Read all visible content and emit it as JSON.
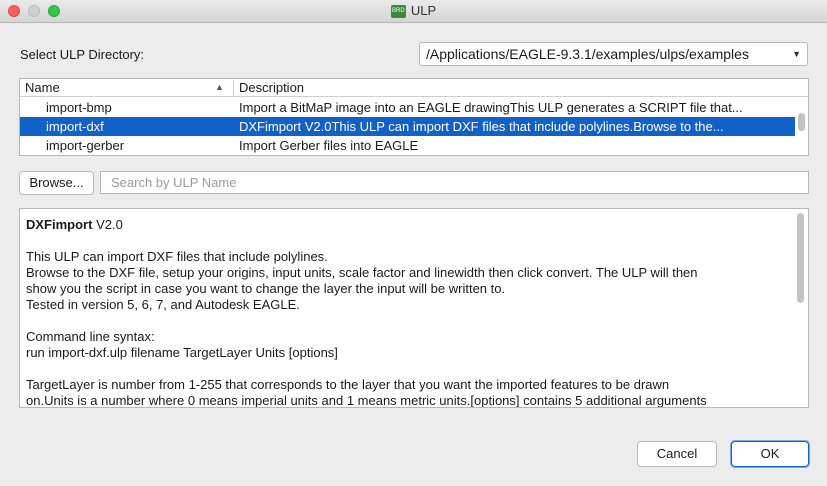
{
  "window": {
    "title": "ULP",
    "app_icon": "eagle-app-icon",
    "icon_text": "BRD"
  },
  "directory": {
    "label": "Select ULP Directory:",
    "value": "/Applications/EAGLE-9.3.1/examples/ulps/examples"
  },
  "table": {
    "columns": [
      "Name",
      "Description"
    ],
    "rows": [
      {
        "name": "import-bmp",
        "description": "Import a BitMaP image into an EAGLE drawingThis ULP generates a SCRIPT file that..."
      },
      {
        "name": "import-dxf",
        "description": "DXFimport V2.0This ULP can import DXF files that include polylines.Browse to the...",
        "selected": true
      },
      {
        "name": "import-gerber",
        "description": "Import Gerber files into EAGLE"
      }
    ]
  },
  "browse": {
    "label": "Browse..."
  },
  "search": {
    "placeholder": "Search by ULP Name"
  },
  "description": {
    "title_bold": "DXFimport",
    "title_rest": " V2.0",
    "lines1": [
      "This ULP can import DXF files that include polylines.",
      "Browse to the DXF file, setup your origins, input units, scale factor and linewidth then click convert. The ULP will then",
      "show you the script in case you want to change the layer the input will be written to.",
      "Tested in version 5, 6, 7, and Autodesk EAGLE."
    ],
    "lines2": [
      "Command line syntax:",
      "run import-dxf.ulp filename TargetLayer Units [options]"
    ],
    "lines3": [
      "TargetLayer is number from 1-255 that corresponds to the layer that you want the imported features to be drawn",
      "on.Units is a number where 0 means imperial units and 1 means metric units.[options] contains 5 additional arguments"
    ]
  },
  "buttons": {
    "cancel": "Cancel",
    "ok": "OK"
  },
  "colors": {
    "selection": "#1261c8",
    "close": "#fc605c",
    "maximize": "#34c84a"
  }
}
